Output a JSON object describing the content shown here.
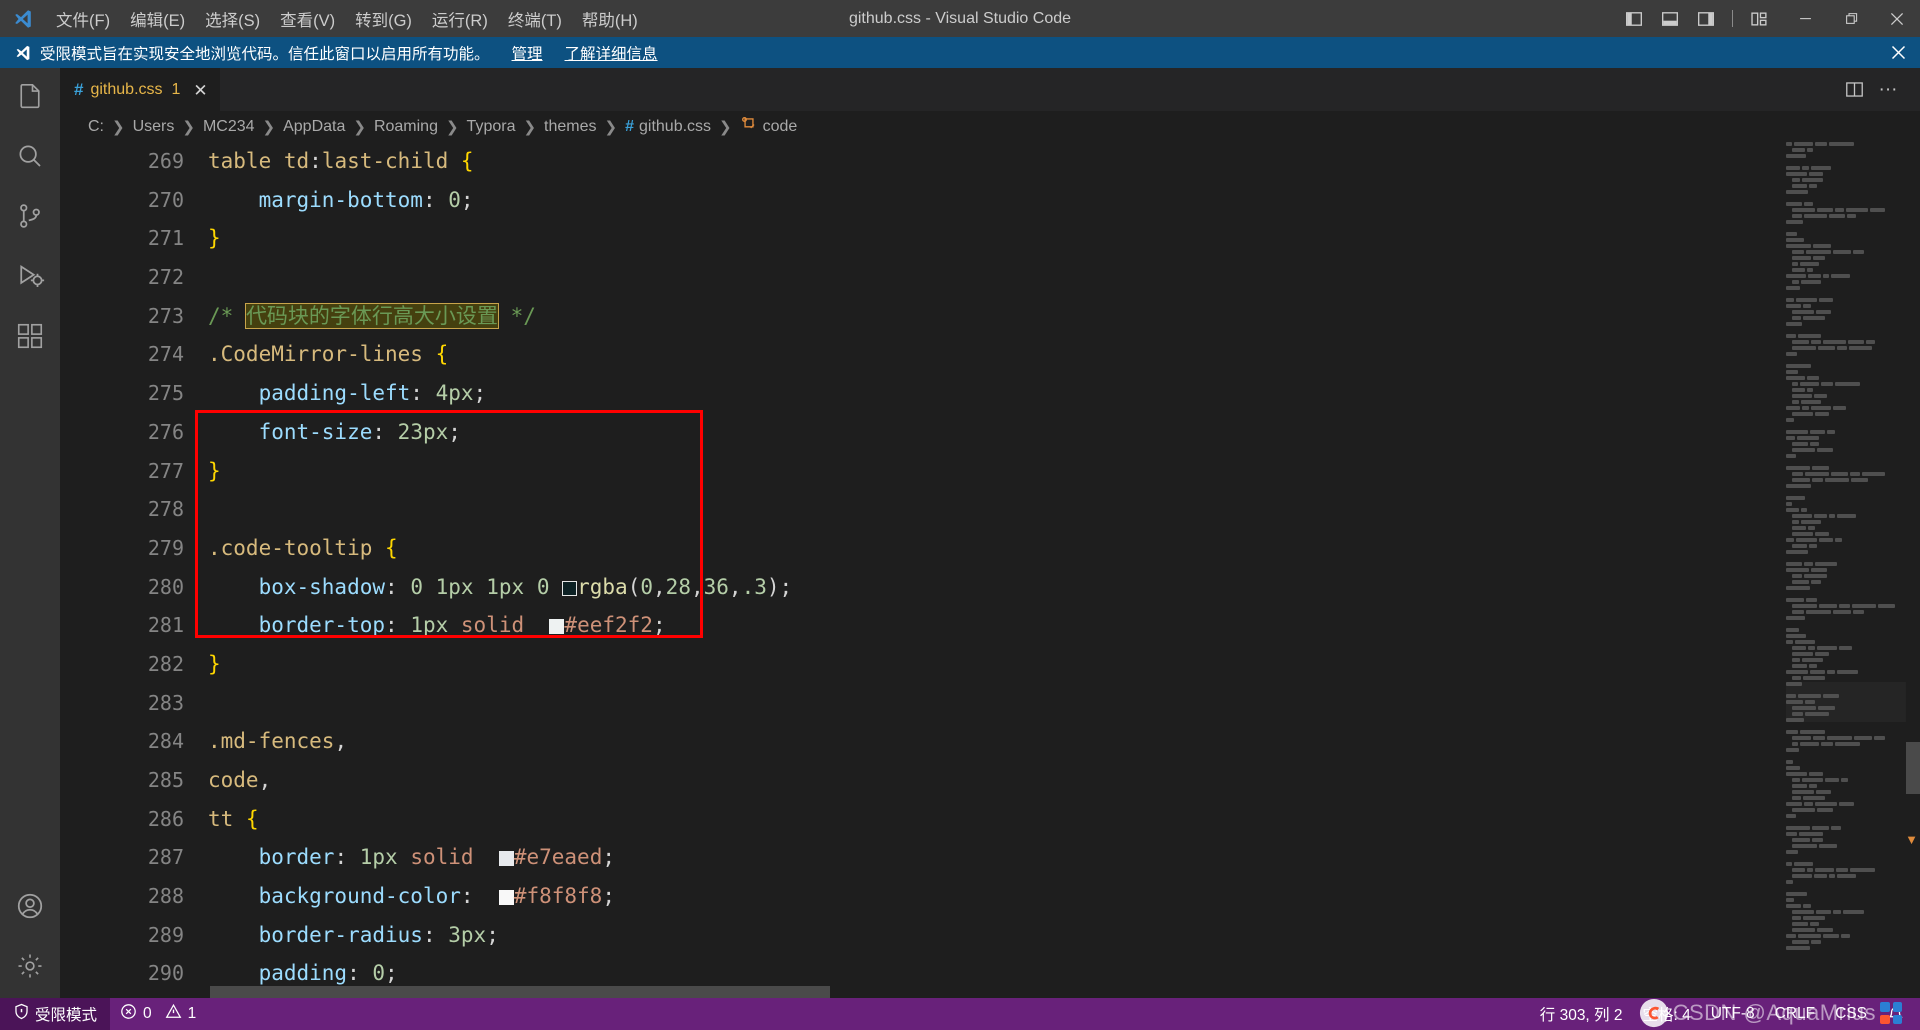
{
  "window": {
    "title": "github.css - Visual Studio Code",
    "logo_name": "vscode-logo"
  },
  "menu": {
    "items": [
      {
        "label": "文件(F)",
        "name": "menu-file"
      },
      {
        "label": "编辑(E)",
        "name": "menu-edit"
      },
      {
        "label": "选择(S)",
        "name": "menu-selection"
      },
      {
        "label": "查看(V)",
        "name": "menu-view"
      },
      {
        "label": "转到(G)",
        "name": "menu-go"
      },
      {
        "label": "运行(R)",
        "name": "menu-run"
      },
      {
        "label": "终端(T)",
        "name": "menu-terminal"
      },
      {
        "label": "帮助(H)",
        "name": "menu-help"
      }
    ]
  },
  "titlebar_controls": {
    "toggle_primary_sidebar": "toggle-primary-sidebar",
    "toggle_panel": "toggle-panel",
    "toggle_secondary_sidebar": "toggle-secondary-sidebar",
    "customize_layout": "customize-layout",
    "minimize": "−",
    "maximize": "❐",
    "close": "✕"
  },
  "notification": {
    "message": "受限模式旨在实现安全地浏览代码。信任此窗口以启用所有功能。",
    "manage_link": "管理",
    "learn_link": "了解详细信息",
    "close": "✕"
  },
  "activitybar": {
    "items": [
      {
        "name": "explorer",
        "icon": "files-icon"
      },
      {
        "name": "search",
        "icon": "search-icon"
      },
      {
        "name": "source-control",
        "icon": "source-control-icon"
      },
      {
        "name": "run-and-debug",
        "icon": "run-debug-icon"
      },
      {
        "name": "extensions",
        "icon": "extensions-icon"
      }
    ],
    "bottom": [
      {
        "name": "accounts",
        "icon": "account-icon"
      },
      {
        "name": "manage",
        "icon": "gear-icon"
      }
    ]
  },
  "tab": {
    "hash_icon": "#",
    "filename": "github.css",
    "badge": "1",
    "close": "✕",
    "split_editor": "split-editor-icon",
    "more_actions": "···"
  },
  "breadcrumb": {
    "segments": [
      {
        "label": "C:",
        "icon": ""
      },
      {
        "label": "Users",
        "icon": ""
      },
      {
        "label": "MC234",
        "icon": ""
      },
      {
        "label": "AppData",
        "icon": ""
      },
      {
        "label": "Roaming",
        "icon": ""
      },
      {
        "label": "Typora",
        "icon": ""
      },
      {
        "label": "themes",
        "icon": ""
      },
      {
        "label": "github.css",
        "icon": "#"
      },
      {
        "label": "code",
        "icon": "symbol"
      }
    ],
    "separator": "❯"
  },
  "editor": {
    "first_line_number": 269,
    "lines": [
      {
        "n": "269",
        "code": "table td:last-child {"
      },
      {
        "n": "270",
        "code": "    margin-bottom: 0;"
      },
      {
        "n": "271",
        "code": "}"
      },
      {
        "n": "272",
        "code": ""
      },
      {
        "n": "273",
        "code": "/* 代码块的字体行高大小设置 */"
      },
      {
        "n": "274",
        "code": ".CodeMirror-lines {"
      },
      {
        "n": "275",
        "code": "    padding-left: 4px;"
      },
      {
        "n": "276",
        "code": "    font-size: 23px;"
      },
      {
        "n": "277",
        "code": "}"
      },
      {
        "n": "278",
        "code": ""
      },
      {
        "n": "279",
        "code": ".code-tooltip {"
      },
      {
        "n": "280",
        "code": "    box-shadow: 0 1px 1px 0 rgba(0,28,36,.3);"
      },
      {
        "n": "281",
        "code": "    border-top: 1px solid #eef2f2;"
      },
      {
        "n": "282",
        "code": "}"
      },
      {
        "n": "283",
        "code": ""
      },
      {
        "n": "284",
        "code": ".md-fences,"
      },
      {
        "n": "285",
        "code": "code,"
      },
      {
        "n": "286",
        "code": "tt {"
      },
      {
        "n": "287",
        "code": "    border: 1px solid #e7eaed;"
      },
      {
        "n": "288",
        "code": "    background-color: #f8f8f8;"
      },
      {
        "n": "289",
        "code": "    border-radius: 3px;"
      },
      {
        "n": "290",
        "code": "    padding: 0;"
      }
    ],
    "highlighted_text": "代码块的字体行高大小设置",
    "annotation_color": "#ff0000",
    "colors": {
      "comment": "#6a9955",
      "selector": "#d7ba7d",
      "property": "#9cdcfe",
      "number": "#b5cea8",
      "string": "#ce9178",
      "background": "#1e1e1e"
    },
    "swatches": {
      "rgba_0_28_36": "#0d2124",
      "eef2f2": "#eef2f2",
      "e7eaed": "#e7eaed",
      "f8f8f8": "#f8f8f8"
    }
  },
  "statusbar": {
    "trusted_label": "受限模式",
    "errors": "0",
    "warnings": "1",
    "line_col": "行 303, 列 2",
    "spaces": "空格: 4",
    "encoding": "UTF-8",
    "eol": "CRLF",
    "language": "CSS",
    "bell": "bell-icon",
    "background": "#68217a"
  },
  "watermark": {
    "text": "CSDN @AquaMrius",
    "logo": "csdn-logo"
  }
}
